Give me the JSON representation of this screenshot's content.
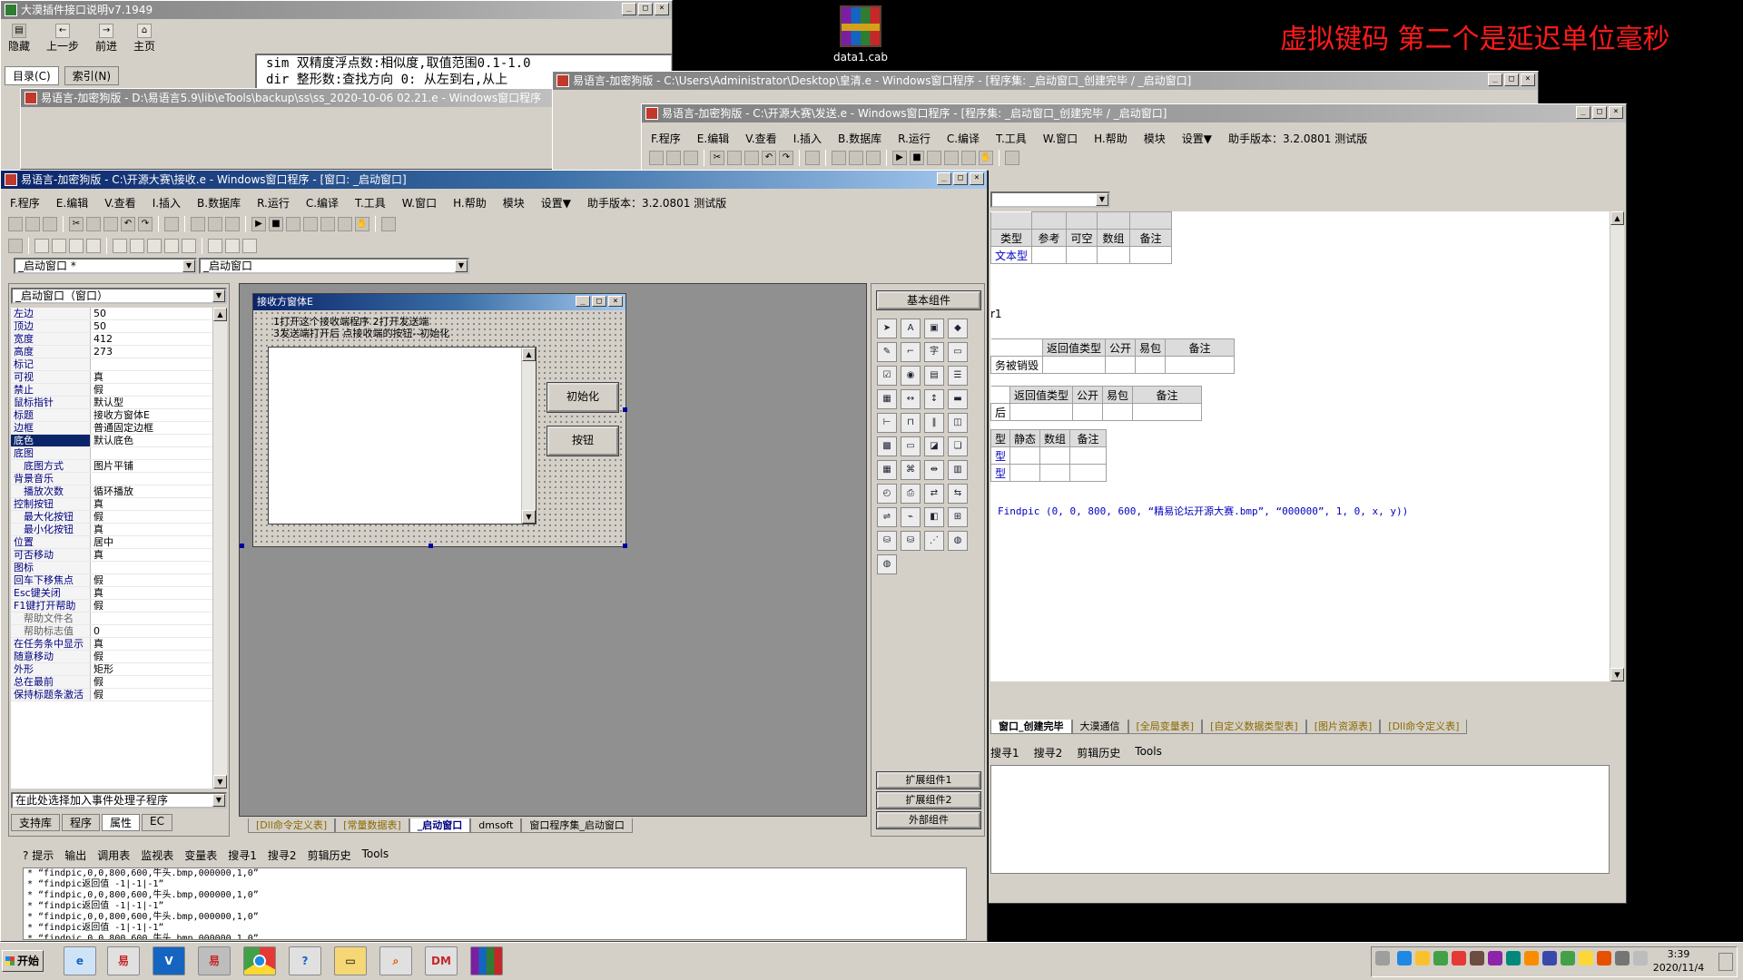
{
  "desktop": {
    "annotation": "虚拟键码 第二个是延迟单位毫秒",
    "icon_label": "data1.cab"
  },
  "help_window": {
    "title": "大漠插件接口说明v7.1949",
    "toolbar": [
      "隐藏",
      "上一步",
      "前进",
      "主页"
    ],
    "tabs": [
      "目录(C)",
      "索引(N)"
    ],
    "content_lines": [
      "sim 双精度浮点数:相似度,取值范围0.1-1.0",
      "dir 整形数:查找方向 0: 从左到右,从上"
    ]
  },
  "bg_window_1": {
    "title": "易语言-加密狗版 - D:\\易语言5.9\\lib\\eTools\\backup\\ss\\ss_2020-10-06 02.21.e - Windows窗口程序"
  },
  "bg_window_2": {
    "title": "易语言-加密狗版 - C:\\Users\\Administrator\\Desktop\\皇清.e - Windows窗口程序 - [程序集: _启动窗口_创建完毕 / _启动窗口]"
  },
  "right_window": {
    "title": "易语言-加密狗版 - C:\\开源大赛\\发送.e - Windows窗口程序 - [程序集: _启动窗口_创建完毕 / _启动窗口]",
    "menu": [
      "F.程序",
      "E.编辑",
      "V.查看",
      "I.插入",
      "B.数据库",
      "R.运行",
      "C.编译",
      "T.工具",
      "W.窗口",
      "H.帮助",
      "模块",
      "设置▼",
      "助手版本：3.2.0801 测试版"
    ],
    "table1": {
      "headers": [
        "类型",
        "参考",
        "可空",
        "数组",
        "备注"
      ],
      "row": "文本型"
    },
    "fragment_r1": "r1",
    "table2": {
      "headers": [
        "返回值类型",
        "公开",
        "易包",
        "备注"
      ],
      "row": "务被销毁"
    },
    "table3": {
      "headers": [
        "返回值类型",
        "公开",
        "易包",
        "备注"
      ],
      "row": "后"
    },
    "table4": {
      "headers": [
        "型",
        "静态",
        "数组",
        "备注"
      ],
      "rows": [
        "型",
        "型"
      ]
    },
    "code": "Findpic (0, 0, 800, 600, “精易论坛开源大赛.bmp”, “000000”, 1, 0, x, y))",
    "tabs": [
      "窗口_创建完毕",
      "大漠通信",
      "[全局变量表]",
      "[自定义数据类型表]",
      "[图片资源表]",
      "[Dll命令定义表]"
    ],
    "bottom_tabs": [
      "搜寻1",
      "搜寻2",
      "剪辑历史",
      "Tools"
    ]
  },
  "main_window": {
    "title": "易语言-加密狗版 - C:\\开源大赛\\接收.e - Windows窗口程序 - [窗口: _启动窗口]",
    "menu": [
      "F.程序",
      "E.编辑",
      "V.查看",
      "I.插入",
      "B.数据库",
      "R.运行",
      "C.编译",
      "T.工具",
      "W.窗口",
      "H.帮助",
      "模块",
      "设置▼",
      "助手版本：3.2.0801 测试版"
    ],
    "window_select": "_启动窗口 *",
    "event_select": "_启动窗口",
    "prop_object": "_启动窗口（窗口）",
    "properties": [
      {
        "k": "左边",
        "v": "50"
      },
      {
        "k": "顶边",
        "v": "50"
      },
      {
        "k": "宽度",
        "v": "412"
      },
      {
        "k": "高度",
        "v": "273"
      },
      {
        "k": "标记",
        "v": ""
      },
      {
        "k": "可视",
        "v": "真"
      },
      {
        "k": "禁止",
        "v": "假"
      },
      {
        "k": "鼠标指针",
        "v": "默认型"
      },
      {
        "k": "标题",
        "v": "接收方窗体E"
      },
      {
        "k": "边框",
        "v": "普通固定边框"
      },
      {
        "k": "底色",
        "v": "默认底色",
        "sel": true
      },
      {
        "k": "底图",
        "v": ""
      },
      {
        "k": "底图方式",
        "v": "图片平铺",
        "indent": true
      },
      {
        "k": "背景音乐",
        "v": ""
      },
      {
        "k": "播放次数",
        "v": "循环播放",
        "indent": true
      },
      {
        "k": "控制按钮",
        "v": "真"
      },
      {
        "k": "最大化按钮",
        "v": "假",
        "indent": true
      },
      {
        "k": "最小化按钮",
        "v": "真",
        "indent": true
      },
      {
        "k": "位置",
        "v": "居中"
      },
      {
        "k": "可否移动",
        "v": "真"
      },
      {
        "k": "图标",
        "v": ""
      },
      {
        "k": "回车下移焦点",
        "v": "假"
      },
      {
        "k": "Esc键关闭",
        "v": "真"
      },
      {
        "k": "F1键打开帮助",
        "v": "假"
      },
      {
        "k": "帮助文件名",
        "v": "",
        "indent": true,
        "grey": true
      },
      {
        "k": "帮助标志值",
        "v": "0",
        "indent": true,
        "grey": true
      },
      {
        "k": "在任务条中显示",
        "v": "真"
      },
      {
        "k": "随意移动",
        "v": "假"
      },
      {
        "k": "外形",
        "v": "矩形"
      },
      {
        "k": "总在最前",
        "v": "假"
      },
      {
        "k": "保持标题条激活",
        "v": "假"
      }
    ],
    "event_handler": "在此处选择加入事件处理子程序",
    "left_tabs": [
      "支持库",
      "程序",
      "属性",
      "EC"
    ],
    "designer_tabs": [
      "[Dll命令定义表]",
      "[常量数据表]",
      "_启动窗口",
      "dmsoft",
      "窗口程序集_启动窗口"
    ],
    "form": {
      "title": "接收方窗体E",
      "label_line1": "1打开这个接收端程序 2打开发送端",
      "label_line2": "3发送端打开后 点接收端的按钮--初始化",
      "button_init": "初始化",
      "button_btn": "按钮"
    },
    "component_header": "基本组件",
    "component_footer": [
      "扩展组件1",
      "扩展组件2",
      "外部组件"
    ],
    "output_tabs": [
      "提示",
      "输出",
      "调用表",
      "监视表",
      "变量表",
      "搜寻1",
      "搜寻2",
      "剪辑历史",
      "Tools"
    ],
    "output_lines": [
      "* “findpic,0,0,800,600,牛头.bmp,000000,1,0”",
      "* “findpic返回值 -1|-1|-1”",
      "* “findpic,0,0,800,600,牛头.bmp,000000,1,0”",
      "* “findpic返回值 -1|-1|-1”",
      "* “findpic,0,0,800,600,牛头.bmp,000000,1,0”",
      "* “findpic返回值 -1|-1|-1”",
      "* “findpic,0,0,800,600,牛头.bmp,000000,1,0”"
    ]
  },
  "taskbar": {
    "start": "开始",
    "items": [
      "IE",
      "E",
      "VS",
      "E2",
      "Chrome",
      "?",
      "Folder",
      "Search",
      "DM",
      "RAR"
    ],
    "dm_label": "DM",
    "time": "3:39",
    "date": "2020/11/4"
  },
  "colors": {
    "title_active": "#0a246a",
    "annotation_red": "#ff1a1a",
    "code_blue": "#0000c0",
    "tab_gold": "#8a6a00"
  }
}
